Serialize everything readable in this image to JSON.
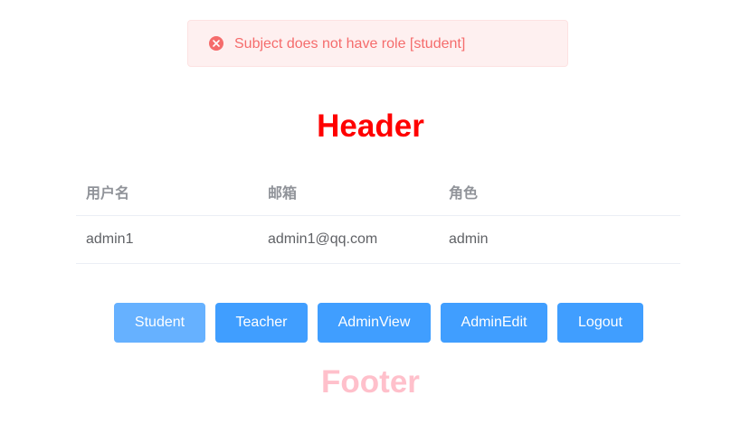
{
  "alert": {
    "icon": "close-circle-icon",
    "message": "Subject does not have role [student]",
    "color": "#f56c6c",
    "background": "#fef0f0"
  },
  "header": {
    "title": "Header",
    "color": "#ff0000"
  },
  "table": {
    "columns": [
      "用户名",
      "邮箱",
      "角色"
    ],
    "rows": [
      [
        "admin1",
        "admin1@qq.com",
        "admin"
      ]
    ]
  },
  "buttons": {
    "student": "Student",
    "teacher": "Teacher",
    "admin_view": "AdminView",
    "admin_edit": "AdminEdit",
    "logout": "Logout",
    "primary_color": "#409eff",
    "hover_color": "#66b1ff"
  },
  "footer": {
    "title": "Footer",
    "color": "#ffc0cb"
  }
}
